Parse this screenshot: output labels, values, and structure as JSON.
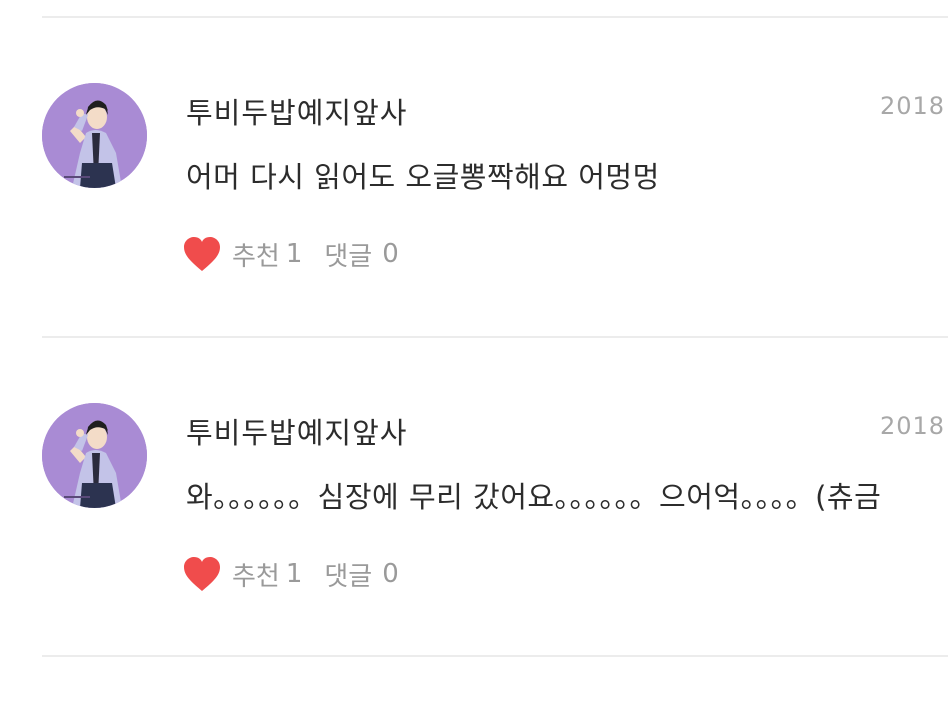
{
  "comments": [
    {
      "author": "투비두밥예지앞사",
      "date": "2018",
      "text": "어머 다시 읽어도 오글뽕짝해요 어멍멍",
      "likes_label": "추천",
      "likes_count": "1",
      "replies_label": "댓글",
      "replies_count": "0"
    },
    {
      "author": "투비두밥예지앞사",
      "date": "2018",
      "text": "와。。。。。。심장에 무리 갔어요。。。。。。으어억。。。。(츄금",
      "likes_label": "추천",
      "likes_count": "1",
      "replies_label": "댓글",
      "replies_count": "0"
    }
  ],
  "colors": {
    "heart": "#f04c4c",
    "avatar_bg": "#a98bd4",
    "divider": "#ececec",
    "meta_text": "#9a9a9a"
  },
  "icons": {
    "heart": "heart-icon",
    "avatar": "avatar-image"
  }
}
